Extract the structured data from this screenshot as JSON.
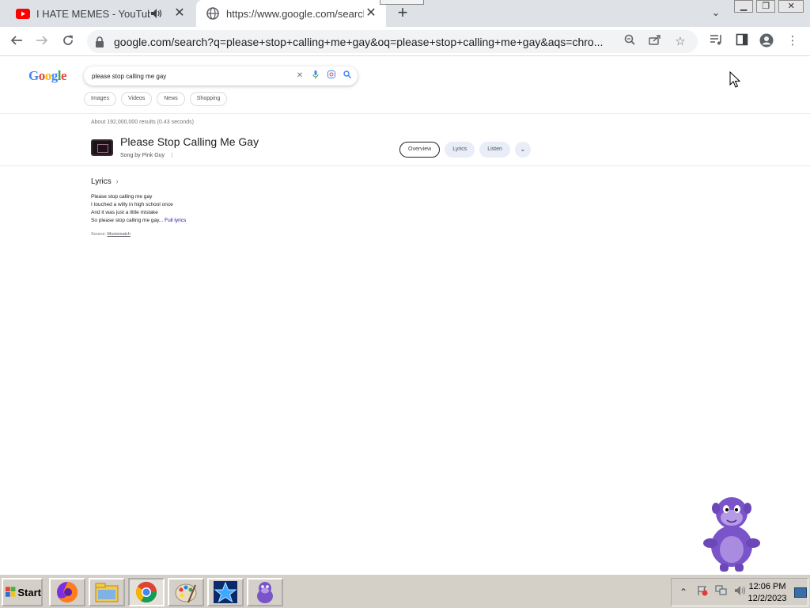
{
  "browser": {
    "tabs": [
      {
        "title": "I HATE MEMES - YouTube",
        "favicon": "youtube-icon",
        "audio": true,
        "active": false
      },
      {
        "title": "https://www.google.com/search?",
        "favicon": "globe-icon",
        "active": true
      }
    ],
    "new_tab": "+",
    "url": "google.com/search?q=please+stop+calling+me+gay&oq=please+stop+calling+me+gay&aqs=chro...",
    "toolbar_icons": [
      "back-icon",
      "forward-icon",
      "reload-icon",
      "lock-icon",
      "zoom-icon",
      "share-icon",
      "star-icon",
      "media-icon",
      "sidepanel-icon",
      "profile-icon",
      "menu-icon"
    ]
  },
  "google": {
    "logo": "Google",
    "query": "please stop calling me gay",
    "filters": [
      "Images",
      "Videos",
      "News",
      "Shopping"
    ],
    "stats": "About 192,000,000 results (0.43 seconds)",
    "knowledge_panel": {
      "title": "Please Stop Calling Me Gay",
      "subtitle": "Song by Pink Guy",
      "tabs": [
        "Overview",
        "Lyrics",
        "Listen"
      ]
    },
    "lyrics": {
      "heading": "Lyrics",
      "lines": [
        "Please stop calling me gay",
        "I touched a willy in high school once",
        "And it was just a little mistake",
        "So please stop calling me gay..."
      ],
      "full_link": "Full lyrics",
      "source_label": "Source:",
      "source_name": "Musixmatch"
    }
  },
  "taskbar": {
    "start_label": "Start",
    "apps": [
      "firefox-icon",
      "file-manager-icon",
      "chrome-icon",
      "paint-icon",
      "star-app-icon",
      "bonzi-icon"
    ],
    "time": "12:06 PM",
    "date": "12/2/2023"
  },
  "colors": {
    "tabstrip": "#dee1e6",
    "taskbar": "#d4d0c8",
    "link": "#1a0dab",
    "bonzi_purple": "#7a55c9"
  }
}
